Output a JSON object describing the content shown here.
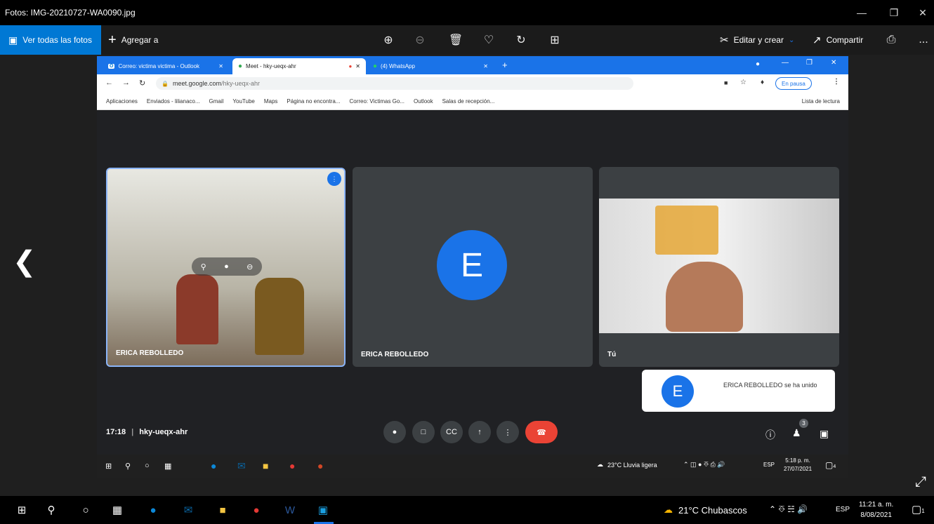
{
  "window": {
    "title": "Fotos: IMG-20210727-WA0090.jpg",
    "controls": [
      "minimize",
      "restore",
      "close"
    ]
  },
  "toolbar": {
    "view_all": "Ver todas las fotos",
    "add_to": "Agregar a",
    "edit_create": "Editar y crear",
    "share": "Compartir",
    "more": "..."
  },
  "browser": {
    "tabs": [
      {
        "label": "Correo: victima victima - Outlook",
        "icon": "outlook-icon"
      },
      {
        "label": "Meet - hky-ueqx-ahr",
        "icon": "meet-icon"
      },
      {
        "label": "(4) WhatsApp",
        "icon": "whatsapp-icon"
      }
    ],
    "url_host": "meet.google.com",
    "url_path": "/hky-ueqx-ahr",
    "paused": "En pausa",
    "bookmarks": [
      "Aplicaciones",
      "Enviados - lilianaco...",
      "Gmail",
      "YouTube",
      "Maps",
      "Página no encontra...",
      "Correo: Victimas Go...",
      "Outlook",
      "Salas de recepción..."
    ],
    "reading_list": "Lista de lectura"
  },
  "meet": {
    "tiles": [
      {
        "name": "ERICA REBOLLEDO"
      },
      {
        "name": "ERICA REBOLLEDO",
        "initial": "E"
      },
      {
        "name": "Tú"
      }
    ],
    "notification": {
      "initial": "E",
      "text": "ERICA REBOLLEDO se ha unido"
    },
    "time": "17:18",
    "meeting_code": "hky-ueqx-ahr",
    "participants_count": "3"
  },
  "inner_taskbar": {
    "weather": "23°C  Lluvia ligera",
    "lang": "ESP",
    "time": "5:18 p. m.",
    "date": "27/07/2021",
    "notif_count": "4"
  },
  "taskbar": {
    "weather": "21°C  Chubascos",
    "lang": "ESP",
    "time": "11:21 a. m.",
    "date": "8/08/2021",
    "notif_count": "1"
  },
  "colors": {
    "accent": "#1a73e8",
    "end_call": "#ea4335",
    "photos_blue": "#0078d4"
  }
}
